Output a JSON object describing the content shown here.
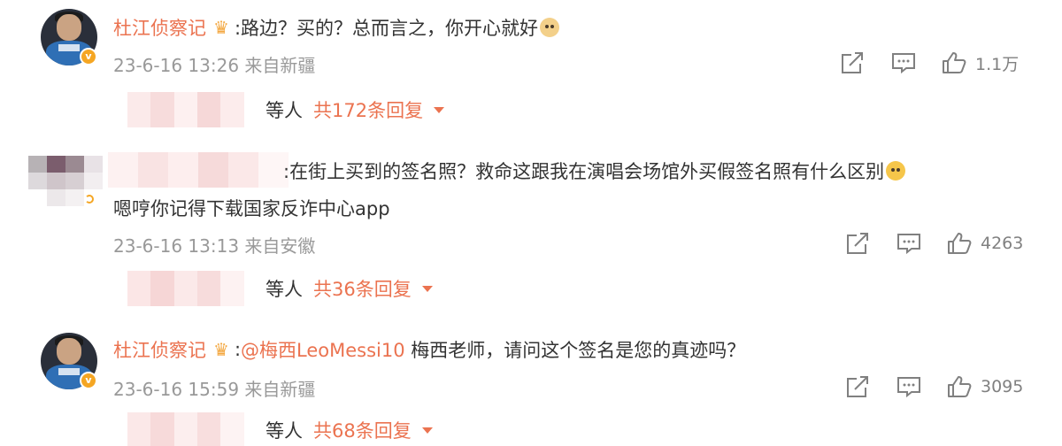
{
  "colors": {
    "accent": "#eb7350",
    "meta": "#999999",
    "text": "#333333",
    "icon": "#808080"
  },
  "comments": [
    {
      "user": "杜江侦察记",
      "text": ":路边？买的？总而言之，你开心就好",
      "emoji": "doge-emoji",
      "time": "23-6-16 13:26",
      "source": "来自新疆",
      "likes": "1.1万",
      "replies": {
        "who": "等人",
        "count": "共172条回复"
      }
    },
    {
      "user": "",
      "text": ":在街上买到的签名照？救命这跟我在演唱会场馆外买假签名照有什么区别",
      "text2": "嗯哼你记得下载国家反诈中心app",
      "emoji": "crying-emoji",
      "time": "23-6-16 13:13",
      "source": "来自安徽",
      "likes": "4263",
      "replies": {
        "who": "等人",
        "count": "共36条回复"
      }
    },
    {
      "user": "杜江侦察记",
      "text_prefix": ":",
      "mention": "@梅西LeoMessi10",
      "text": " 梅西老师，请问这个签名是您的真迹吗？",
      "time": "23-6-16 15:59",
      "source": "来自新疆",
      "likes": "3095",
      "replies": {
        "who": "等人",
        "count": "共68条回复"
      }
    }
  ]
}
